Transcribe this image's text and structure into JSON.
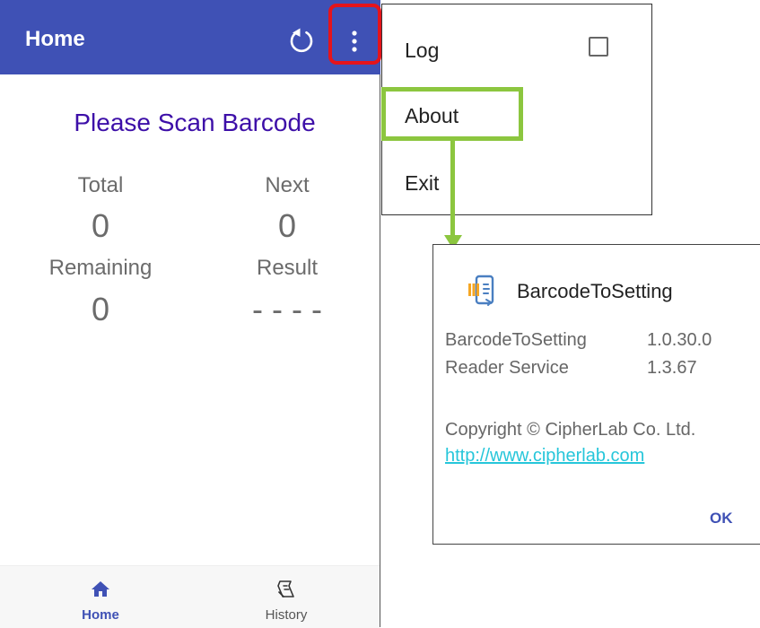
{
  "app": {
    "title": "Home",
    "prompt": "Please Scan Barcode",
    "stats": {
      "total_label": "Total",
      "total_value": "0",
      "next_label": "Next",
      "next_value": "0",
      "remaining_label": "Remaining",
      "remaining_value": "0",
      "result_label": "Result",
      "result_value": "- - - -"
    },
    "nav": {
      "home_label": "Home",
      "history_label": "History"
    }
  },
  "menu": {
    "log_label": "Log",
    "log_checked": false,
    "about_label": "About",
    "exit_label": "Exit"
  },
  "about_dialog": {
    "app_name": "BarcodeToSetting",
    "rows": [
      {
        "name": "BarcodeToSetting",
        "version": "1.0.30.0"
      },
      {
        "name": "Reader Service",
        "version": "1.3.67"
      }
    ],
    "copyright": "Copyright © CipherLab Co. Ltd.",
    "link": "http://www.cipherlab.com",
    "ok_label": "OK"
  },
  "icons": {
    "refresh": "refresh-icon",
    "more": "more-vert-icon",
    "home": "home-icon",
    "history": "history-icon",
    "app": "barcode-to-setting-app-icon"
  },
  "colors": {
    "appbar": "#3f51b5",
    "prompt": "#3d0fa8",
    "highlight_red": "#e5141b",
    "highlight_green": "#8cc63f",
    "link": "#26c6da"
  }
}
